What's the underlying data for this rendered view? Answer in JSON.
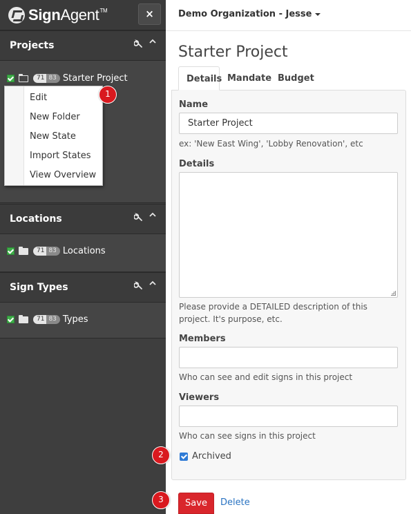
{
  "brand": {
    "name_bold": "Sign",
    "name_rest": "Agent",
    "tm": "TM",
    "close_glyph": "×"
  },
  "sidebar": {
    "panels": [
      {
        "title": "Projects",
        "tree": [
          {
            "count_a": "71",
            "count_b": "83",
            "label": "Starter Project"
          }
        ]
      },
      {
        "title": "Locations",
        "tree": [
          {
            "count_a": "71",
            "count_b": "83",
            "label": "Locations"
          }
        ]
      },
      {
        "title": "Sign Types",
        "tree": [
          {
            "count_a": "71",
            "count_b": "83",
            "label": "Types"
          }
        ]
      }
    ],
    "wrench_glyph": "🔧",
    "chevron_glyph": "⌃"
  },
  "context_menu": {
    "items": [
      "Edit",
      "New Folder",
      "New State",
      "Import States",
      "View Overview"
    ]
  },
  "badges": [
    "1",
    "2",
    "3"
  ],
  "topbar": {
    "org_label": "Demo Organization - Jesse"
  },
  "main": {
    "title": "Starter Project",
    "tabs": [
      "Details",
      "Mandate",
      "Budget"
    ],
    "form": {
      "name_label": "Name",
      "name_value": "Starter Project",
      "name_help": "ex: 'New East Wing', 'Lobby Renovation', etc",
      "details_label": "Details",
      "details_help": "Please provide a DETAILED description of this project. It's purpose, etc.",
      "members_label": "Members",
      "members_help": "Who can see and edit signs in this project",
      "viewers_label": "Viewers",
      "viewers_help": "Who can see signs in this project",
      "archived_label": "Archived",
      "archived_checked": true
    },
    "actions": {
      "save_label": "Save",
      "delete_label": "Delete"
    }
  },
  "colors": {
    "accent_red": "#d9262c",
    "link_blue": "#2a73c2",
    "sidebar_bg": "#3e3e3e",
    "check_green": "#3fae49"
  },
  "icons": [
    "logo-icon",
    "close-icon",
    "wrench-icon",
    "chevron-up-icon",
    "checkbox-icon",
    "folder-open-icon",
    "folder-icon",
    "caret-down-icon",
    "checkbox-checked-icon"
  ]
}
